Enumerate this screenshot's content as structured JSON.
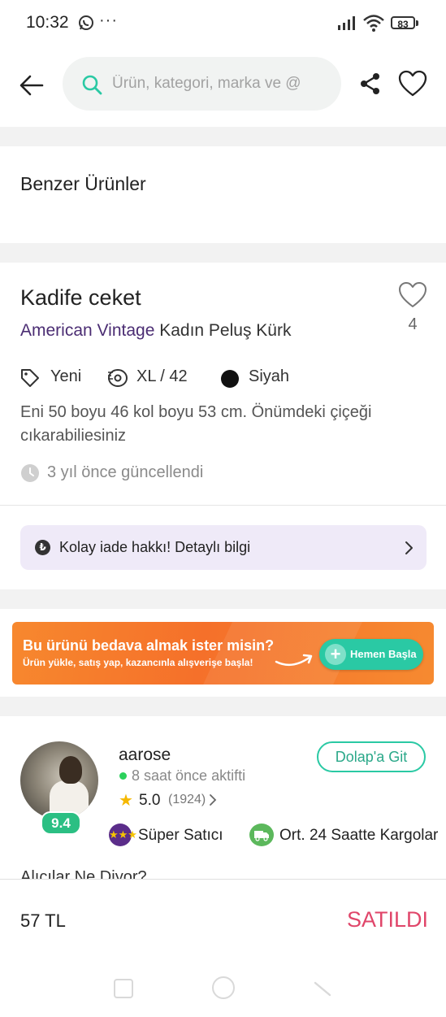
{
  "status_bar": {
    "time": "10:32",
    "more": "···",
    "battery": "83"
  },
  "header": {
    "search_placeholder": "Ürün, kategori, marka ve @"
  },
  "similar": {
    "title": "Benzer Ürünler"
  },
  "product": {
    "title": "Kadife ceket",
    "favorites": "4",
    "brand": "American Vintage",
    "category": " Kadın Peluş Kürk",
    "condition": "Yeni",
    "size": "XL / 42",
    "color": "Siyah",
    "description": "Eni 50 boyu 46 kol boyu 53 cm. Önümdeki çiçeği cıkarabiliesiniz",
    "updated": "3 yıl önce güncellendi"
  },
  "return_info": {
    "icon": "₺",
    "text": "Kolay iade hakkı! Detaylı bilgi"
  },
  "promo": {
    "title": "Bu ürünü bedava almak ister misin?",
    "subtitle": "Ürün yükle, satış yap, kazancınla alışverişe başla!",
    "button": "Hemen Başla",
    "plus": "+"
  },
  "seller": {
    "name": "aarose",
    "score": "9.4",
    "active": "8 saat önce aktifti",
    "star": "★",
    "rating": "5.0",
    "rating_count": "(1924)",
    "closet_button": "Dolap'a Git",
    "badge_super": "Süper Satıcı",
    "badge_cargo": "Ort. 24 Saatte Kargolar",
    "super_icon": "★★★"
  },
  "comments_title": "Alıcılar Ne Diyor?",
  "bottom": {
    "price": "57 TL",
    "status": "SATILDI"
  },
  "colors": {
    "accent": "#2ac9a4",
    "brand": "#4b2d73",
    "sold": "#e0466a",
    "promo": "#f5702a"
  }
}
